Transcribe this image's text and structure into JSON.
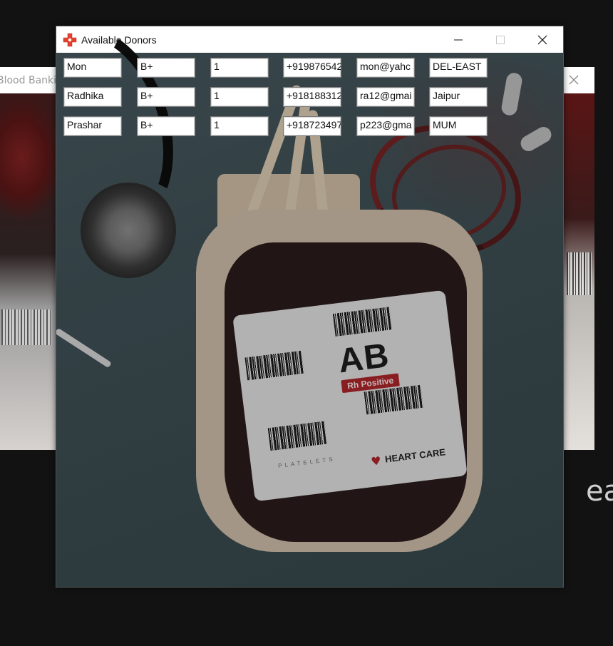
{
  "background_window": {
    "title": "Blood Banking"
  },
  "window": {
    "title": "Available Donors"
  },
  "donors": [
    {
      "name": "Mon",
      "blood_group": "B+",
      "units": "1",
      "phone": "+919876542",
      "email": "mon@yahc",
      "city": "DEL-EAST"
    },
    {
      "name": "Radhika",
      "blood_group": "B+",
      "units": "1",
      "phone": "+918188312",
      "email": "ra12@gmai",
      "city": "Jaipur"
    },
    {
      "name": "Prashar",
      "blood_group": "B+",
      "units": "1",
      "phone": "+918723497",
      "email": "p223@gma",
      "city": "MUM"
    }
  ],
  "photo": {
    "blood_type": "AB",
    "rh_label": "Rh Positive",
    "product_label": "PLATELETS",
    "brand": "HEART CARE"
  },
  "background_text": {
    "ea": "ea"
  },
  "icons": {
    "app": "red-cross-icon",
    "minimize": "minimize-icon",
    "maximize": "maximize-icon",
    "close": "close-icon"
  },
  "colors": {
    "accent": "#e2412c",
    "titlebar": "#ffffff",
    "backdrop": "#121212"
  }
}
